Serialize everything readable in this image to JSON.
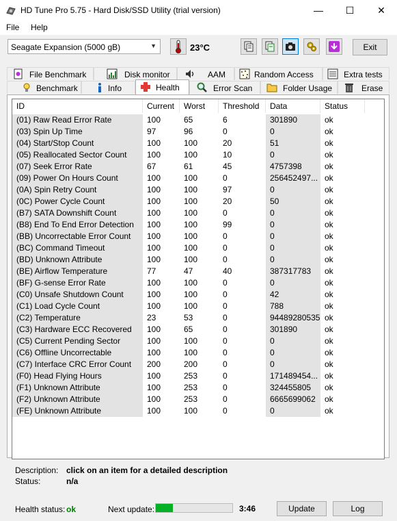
{
  "window": {
    "title": "HD Tune Pro 5.75 - Hard Disk/SSD Utility (trial version)",
    "minimize": "—",
    "maximize": "☐",
    "close": "✕"
  },
  "menu": {
    "file": "File",
    "help": "Help"
  },
  "toolbar": {
    "drive": "Seagate Expansion (5000 gB)",
    "temperature": "23°C",
    "exit_label": "Exit",
    "buttons": [
      "copy-info-icon",
      "copy-text-icon",
      "screenshot-icon",
      "options-icon",
      "save-icon"
    ]
  },
  "tabs_top": [
    {
      "label": "File Benchmark",
      "icon": "file-benchmark-icon"
    },
    {
      "label": "Disk monitor",
      "icon": "disk-monitor-icon"
    },
    {
      "label": "AAM",
      "icon": "aam-icon"
    },
    {
      "label": "Random Access",
      "icon": "random-access-icon"
    },
    {
      "label": "Extra tests",
      "icon": "extra-tests-icon"
    }
  ],
  "tabs_bottom": [
    {
      "label": "Benchmark",
      "icon": "benchmark-icon"
    },
    {
      "label": "Info",
      "icon": "info-icon"
    },
    {
      "label": "Health",
      "icon": "health-icon"
    },
    {
      "label": "Error Scan",
      "icon": "error-scan-icon"
    },
    {
      "label": "Folder Usage",
      "icon": "folder-usage-icon"
    },
    {
      "label": "Erase",
      "icon": "erase-icon"
    }
  ],
  "table": {
    "headers": [
      "ID",
      "Current",
      "Worst",
      "Threshold",
      "Data",
      "Status"
    ],
    "rows": [
      [
        "(01) Raw Read Error Rate",
        "100",
        "65",
        "6",
        "301890",
        "ok"
      ],
      [
        "(03) Spin Up Time",
        "97",
        "96",
        "0",
        "0",
        "ok"
      ],
      [
        "(04) Start/Stop Count",
        "100",
        "100",
        "20",
        "51",
        "ok"
      ],
      [
        "(05) Reallocated Sector Count",
        "100",
        "100",
        "10",
        "0",
        "ok"
      ],
      [
        "(07) Seek Error Rate",
        "67",
        "61",
        "45",
        "4757398",
        "ok"
      ],
      [
        "(09) Power On Hours Count",
        "100",
        "100",
        "0",
        "256452497...",
        "ok"
      ],
      [
        "(0A) Spin Retry Count",
        "100",
        "100",
        "97",
        "0",
        "ok"
      ],
      [
        "(0C) Power Cycle Count",
        "100",
        "100",
        "20",
        "50",
        "ok"
      ],
      [
        "(B7) SATA Downshift Count",
        "100",
        "100",
        "0",
        "0",
        "ok"
      ],
      [
        "(B8) End To End Error Detection",
        "100",
        "100",
        "99",
        "0",
        "ok"
      ],
      [
        "(BB) Uncorrectable Error Count",
        "100",
        "100",
        "0",
        "0",
        "ok"
      ],
      [
        "(BC) Command Timeout",
        "100",
        "100",
        "0",
        "0",
        "ok"
      ],
      [
        "(BD) Unknown Attribute",
        "100",
        "100",
        "0",
        "0",
        "ok"
      ],
      [
        "(BE) Airflow Temperature",
        "77",
        "47",
        "40",
        "387317783",
        "ok"
      ],
      [
        "(BF) G-sense Error Rate",
        "100",
        "100",
        "0",
        "0",
        "ok"
      ],
      [
        "(C0) Unsafe Shutdown Count",
        "100",
        "100",
        "0",
        "42",
        "ok"
      ],
      [
        "(C1) Load Cycle Count",
        "100",
        "100",
        "0",
        "788",
        "ok"
      ],
      [
        "(C2) Temperature",
        "23",
        "53",
        "0",
        "94489280535",
        "ok"
      ],
      [
        "(C3) Hardware ECC Recovered",
        "100",
        "65",
        "0",
        "301890",
        "ok"
      ],
      [
        "(C5) Current Pending Sector",
        "100",
        "100",
        "0",
        "0",
        "ok"
      ],
      [
        "(C6) Offline Uncorrectable",
        "100",
        "100",
        "0",
        "0",
        "ok"
      ],
      [
        "(C7) Interface CRC Error Count",
        "200",
        "200",
        "0",
        "0",
        "ok"
      ],
      [
        "(F0) Head Flying Hours",
        "100",
        "253",
        "0",
        "171489454...",
        "ok"
      ],
      [
        "(F1) Unknown Attribute",
        "100",
        "253",
        "0",
        "324455805",
        "ok"
      ],
      [
        "(F2) Unknown Attribute",
        "100",
        "253",
        "0",
        "6665699062",
        "ok"
      ],
      [
        "(FE) Unknown Attribute",
        "100",
        "100",
        "0",
        "0",
        "ok"
      ]
    ]
  },
  "description": {
    "label": "Description:",
    "value": "click on an item for a detailed description",
    "status_label": "Status:",
    "status_value": "n/a"
  },
  "footer": {
    "health_label": "Health status:",
    "health_value": "ok",
    "next_update_label": "Next update:",
    "progress_fraction": 0.22,
    "timer": "3:46",
    "update_label": "Update",
    "log_label": "Log"
  },
  "colors": {
    "accent": "#0078d7",
    "progress": "#06b025",
    "ok_green": "#008000",
    "thermometer": "#c00000"
  }
}
